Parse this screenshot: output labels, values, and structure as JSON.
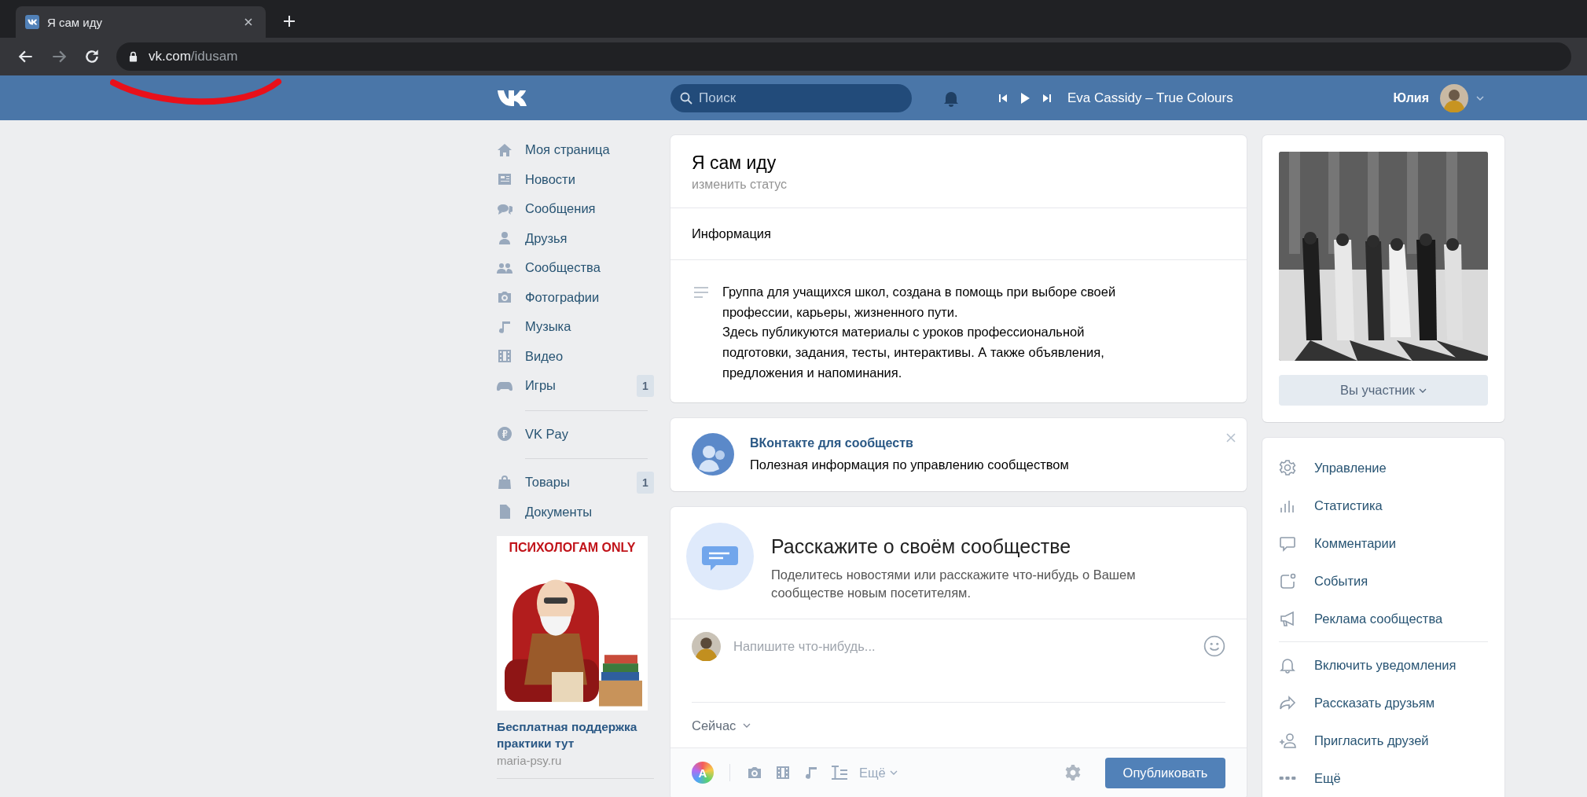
{
  "browser": {
    "tab_title": "Я сам иду",
    "url_host": "vk.com",
    "url_path": "/idusam"
  },
  "header": {
    "search_placeholder": "Поиск",
    "track": "Eva Cassidy – True Colours",
    "user_name": "Юлия"
  },
  "nav": {
    "groups": [
      [
        {
          "label": "Моя страница"
        },
        {
          "label": "Новости"
        },
        {
          "label": "Сообщения"
        },
        {
          "label": "Друзья"
        },
        {
          "label": "Сообщества"
        },
        {
          "label": "Фотографии"
        },
        {
          "label": "Музыка"
        },
        {
          "label": "Видео"
        },
        {
          "label": "Игры",
          "badge": "1"
        }
      ],
      [
        {
          "label": "VK Pay"
        }
      ],
      [
        {
          "label": "Товары",
          "badge": "1"
        },
        {
          "label": "Документы"
        }
      ]
    ]
  },
  "ad": {
    "banner_text": "ПСИХОЛОГАМ ONLY",
    "title": "Бесплатная поддержка практики тут",
    "domain": "maria-psy.ru"
  },
  "profile": {
    "name": "Я сам иду",
    "status_link": "изменить статус",
    "info_heading": "Информация",
    "description": [
      "Группа для учащихся школ, создана в помощь при выборе своей профессии, карьеры, жизненного пути.",
      "Здесь публикуются материалы с уроков профессиональной подготовки, задания, тесты, интерактивы. А также объявления, предложения и напоминания."
    ]
  },
  "promo": {
    "title": "ВКонтакте для сообществ",
    "text": "Полезная информация по управлению сообществом"
  },
  "composer": {
    "title": "Расскажите о своём сообществе",
    "text": "Поделитесь новостями или расскажите что-нибудь о Вашем сообществе новым посетителям.",
    "placeholder": "Напишите что-нибудь...",
    "time": "Сейчас",
    "poster_label": "A",
    "more": "Ещё",
    "publish": "Опубликовать"
  },
  "side": {
    "member_button": "Вы участник",
    "menu_groups": [
      [
        {
          "label": "Управление"
        },
        {
          "label": "Статистика"
        },
        {
          "label": "Комментарии"
        },
        {
          "label": "События"
        },
        {
          "label": "Реклама сообщества"
        }
      ],
      [
        {
          "label": "Включить уведомления"
        },
        {
          "label": "Рассказать друзьям"
        },
        {
          "label": "Пригласить друзей"
        },
        {
          "label": "Ещё"
        }
      ]
    ]
  }
}
